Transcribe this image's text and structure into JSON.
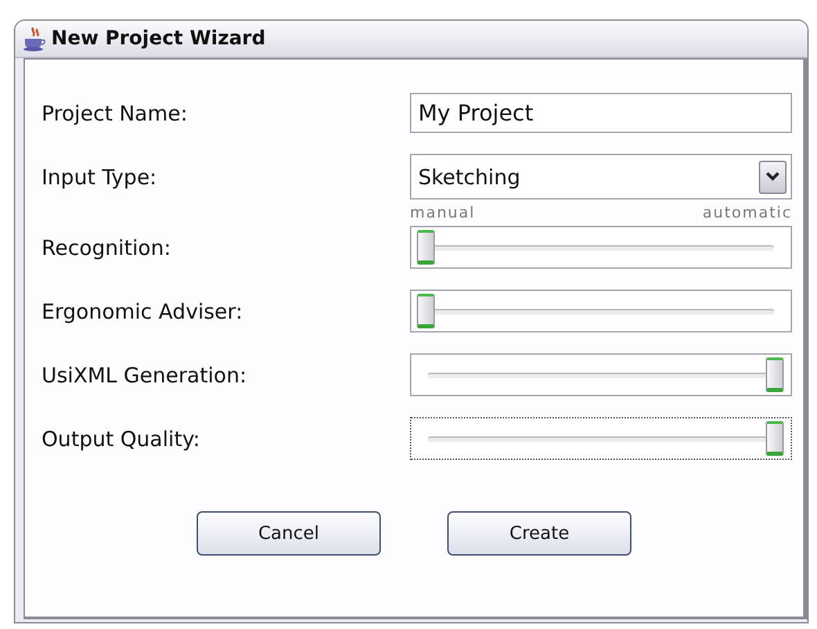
{
  "window": {
    "title": "New Project Wizard"
  },
  "project_name": {
    "label": "Project Name:",
    "value": "My Project"
  },
  "input_type": {
    "label": "Input Type:",
    "value": "Sketching"
  },
  "scale": {
    "min_label": "manual",
    "max_label": "automatic"
  },
  "sliders": [
    {
      "label": "Recognition:",
      "level": 0,
      "focused": false
    },
    {
      "label": "Ergonomic Adviser:",
      "level": 0,
      "focused": false
    },
    {
      "label": "UsiXML Generation:",
      "level": 1,
      "focused": false
    },
    {
      "label": "Output Quality:",
      "level": 1,
      "focused": true
    }
  ],
  "buttons": [
    "Cancel",
    "Create"
  ]
}
